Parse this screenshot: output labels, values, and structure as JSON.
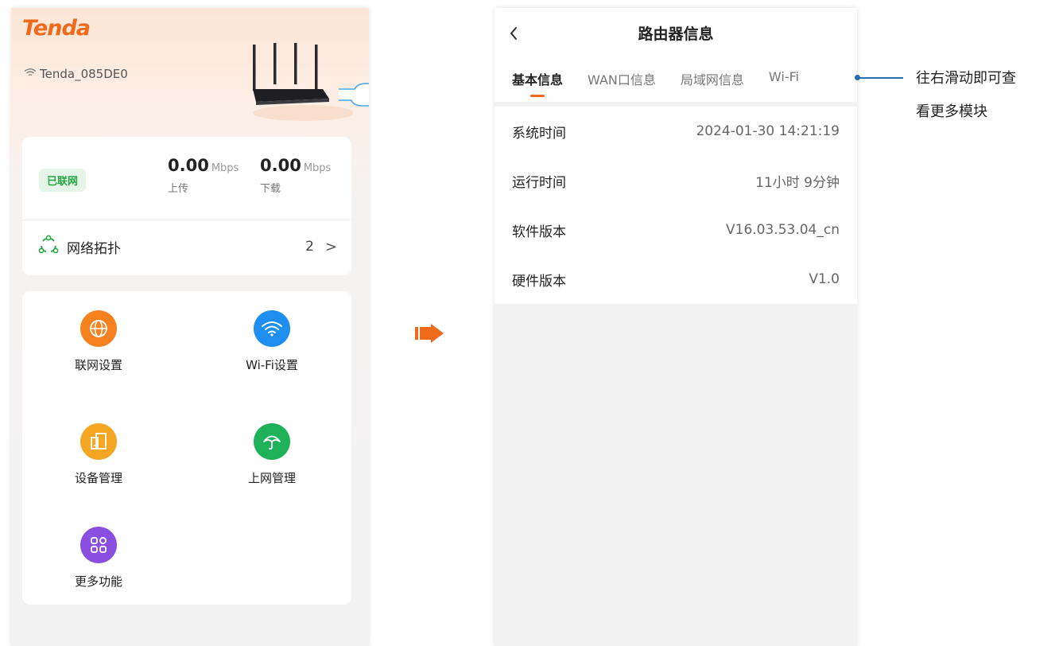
{
  "left_screen": {
    "brand": "Tenda",
    "ssid": "Tenda_085DE0",
    "status_badge": "已联网",
    "upload": {
      "value": "0.00",
      "unit": "Mbps",
      "label": "上传"
    },
    "download": {
      "value": "0.00",
      "unit": "Mbps",
      "label": "下载"
    },
    "topology": {
      "label": "网络拓扑",
      "count": "2"
    },
    "menu": [
      {
        "label": "联网设置",
        "icon": "globe-icon",
        "color": "#f5811f"
      },
      {
        "label": "Wi-Fi设置",
        "icon": "wifi-icon",
        "color": "#1e8ef0"
      },
      {
        "label": "设备管理",
        "icon": "device-icon",
        "color": "#f5a623"
      },
      {
        "label": "上网管理",
        "icon": "umbrella-icon",
        "color": "#1fb15a"
      },
      {
        "label": "更多功能",
        "icon": "grid-icon",
        "color": "#8a4fe0"
      }
    ]
  },
  "right_screen": {
    "title": "路由器信息",
    "tabs": [
      "基本信息",
      "WAN口信息",
      "局域网信息",
      "Wi-Fi"
    ],
    "active_tab": "基本信息",
    "rows": [
      {
        "key": "系统时间",
        "value": "2024-01-30 14:21:19"
      },
      {
        "key": "运行时间",
        "value": "11小时 9分钟"
      },
      {
        "key": "软件版本",
        "value": "V16.03.53.04_cn"
      },
      {
        "key": "硬件版本",
        "value": "V1.0"
      }
    ]
  },
  "callout": {
    "line1": "往右滑动即可查",
    "line2": "看更多模块"
  },
  "colors": {
    "accent": "#f06a1c",
    "callout_line": "#2b6cb0"
  }
}
